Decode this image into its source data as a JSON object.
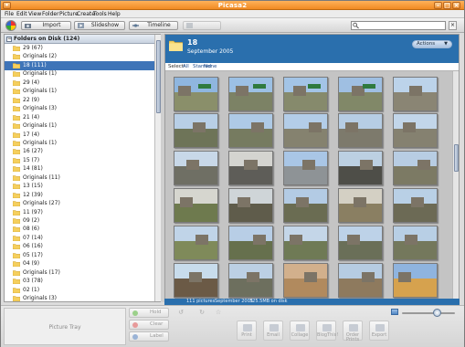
{
  "window": {
    "title": "Picasa2",
    "accent": "#f08a22",
    "selection_color": "#3e74b8",
    "header_color": "#2a6fad"
  },
  "menu": [
    "File",
    "Edit",
    "View",
    "Folder",
    "Picture",
    "Create",
    "Tools",
    "Help"
  ],
  "toolbar": {
    "import_label": "Import",
    "slideshow_label": "Slideshow",
    "timeline_label": "Timeline",
    "search_placeholder": "",
    "icons": [
      "picasa-logo-icon",
      "import-icon",
      "slideshow-icon",
      "timeline-icon",
      "search-icon"
    ]
  },
  "left_pane": {
    "header": "Folders on Disk (124)",
    "folders": [
      {
        "label": "29 (67)",
        "selected": false
      },
      {
        "label": "Originals (2)",
        "selected": false
      },
      {
        "label": "18 (111)",
        "selected": true
      },
      {
        "label": "Originals (1)",
        "selected": false
      },
      {
        "label": "29 (4)",
        "selected": false
      },
      {
        "label": "Originals (1)",
        "selected": false
      },
      {
        "label": "22 (9)",
        "selected": false
      },
      {
        "label": "Originals (3)",
        "selected": false
      },
      {
        "label": "21 (4)",
        "selected": false
      },
      {
        "label": "Originals (1)",
        "selected": false
      },
      {
        "label": "17 (4)",
        "selected": false
      },
      {
        "label": "Originals (1)",
        "selected": false
      },
      {
        "label": "16 (27)",
        "selected": false
      },
      {
        "label": "15 (7)",
        "selected": false
      },
      {
        "label": "14 (81)",
        "selected": false
      },
      {
        "label": "Originals (11)",
        "selected": false
      },
      {
        "label": "13 (15)",
        "selected": false
      },
      {
        "label": "12 (39)",
        "selected": false
      },
      {
        "label": "Originals (27)",
        "selected": false
      },
      {
        "label": "11 (97)",
        "selected": false
      },
      {
        "label": "09 (2)",
        "selected": false
      },
      {
        "label": "08 (6)",
        "selected": false
      },
      {
        "label": "07 (14)",
        "selected": false
      },
      {
        "label": "06 (16)",
        "selected": false
      },
      {
        "label": "05 (17)",
        "selected": false
      },
      {
        "label": "04 (9)",
        "selected": false
      },
      {
        "label": "Originals (17)",
        "selected": false
      },
      {
        "label": "03 (78)",
        "selected": false
      },
      {
        "label": "02 (1)",
        "selected": false
      },
      {
        "label": "Originals (3)",
        "selected": false
      }
    ]
  },
  "right_pane": {
    "folder_title": "18",
    "folder_date": "September 2005",
    "actions_label": "Actions",
    "select_label": "Select:",
    "select_all": "All",
    "select_starred": "Starred",
    "select_none": "None"
  },
  "status": {
    "count": "111 pictures",
    "date": "September 2005",
    "size": "325.5MB on disk"
  },
  "bottom": {
    "tray_label": "Picture Tray",
    "hold_label": "Hold",
    "clear_label": "Clear",
    "label_label": "Label",
    "actions": [
      "Print",
      "Email",
      "Collage",
      "BlogThis!",
      "Order Prints",
      "Export"
    ],
    "zoom_level": 0.66
  },
  "thumbnails": [
    {
      "sky": "#8fb6df",
      "ground": "#8a8f6a",
      "sign": true
    },
    {
      "sky": "#9cc0e4",
      "ground": "#7c8265",
      "sign": true
    },
    {
      "sky": "#a3c4e6",
      "ground": "#868a6c",
      "sign": true
    },
    {
      "sky": "#9fbfe2",
      "ground": "#818868",
      "sign": true
    },
    {
      "sky": "#bcd3ea",
      "ground": "#8a8574",
      "sign": false
    },
    {
      "sky": "#b8cfe6",
      "ground": "#6e7458",
      "sign": false
    },
    {
      "sky": "#aecae6",
      "ground": "#767b60",
      "sign": false
    },
    {
      "sky": "#b3cde8",
      "ground": "#85826f",
      "sign": false
    },
    {
      "sky": "#b6cde4",
      "ground": "#7d7a6c",
      "sign": false
    },
    {
      "sky": "#c2d6ea",
      "ground": "#858170",
      "sign": false
    },
    {
      "sky": "#c8d8e8",
      "ground": "#6f6f64",
      "sign": false
    },
    {
      "sky": "#d4d4d0",
      "ground": "#5e5d58",
      "sign": false
    },
    {
      "sky": "#a9c6e6",
      "ground": "#8e9396",
      "sign": false
    },
    {
      "sky": "#bcd0e2",
      "ground": "#4e4e48",
      "sign": false
    },
    {
      "sky": "#b8cde3",
      "ground": "#7c7a64",
      "sign": false
    },
    {
      "sky": "#d6d6cf",
      "ground": "#6e7a4e",
      "sign": false
    },
    {
      "sky": "#cfd5d8",
      "ground": "#5f5c4b",
      "sign": false
    },
    {
      "sky": "#b3cbe4",
      "ground": "#6a6c52",
      "sign": false
    },
    {
      "sky": "#d4d0c4",
      "ground": "#8a7f62",
      "sign": false
    },
    {
      "sky": "#b9d0e6",
      "ground": "#6c6a55",
      "sign": false
    },
    {
      "sky": "#c0d4e8",
      "ground": "#7f8a5a",
      "sign": false
    },
    {
      "sky": "#b8cee6",
      "ground": "#66704d",
      "sign": false
    },
    {
      "sky": "#c4d6e8",
      "ground": "#6f7a55",
      "sign": false
    },
    {
      "sky": "#bdd2e8",
      "ground": "#6a6f58",
      "sign": false
    },
    {
      "sky": "#b8cfe5",
      "ground": "#74785c",
      "sign": false
    },
    {
      "sky": "#c8dcec",
      "ground": "#6b5a46",
      "sign": false
    },
    {
      "sky": "#bcd0e4",
      "ground": "#6d6f5e",
      "sign": false
    },
    {
      "sky": "#d2b08c",
      "ground": "#b18a5e",
      "sign": false
    },
    {
      "sky": "#b6cce2",
      "ground": "#8e7a5e",
      "sign": false
    },
    {
      "sky": "#8fb4df",
      "ground": "#d6a24e",
      "sign": false
    }
  ]
}
